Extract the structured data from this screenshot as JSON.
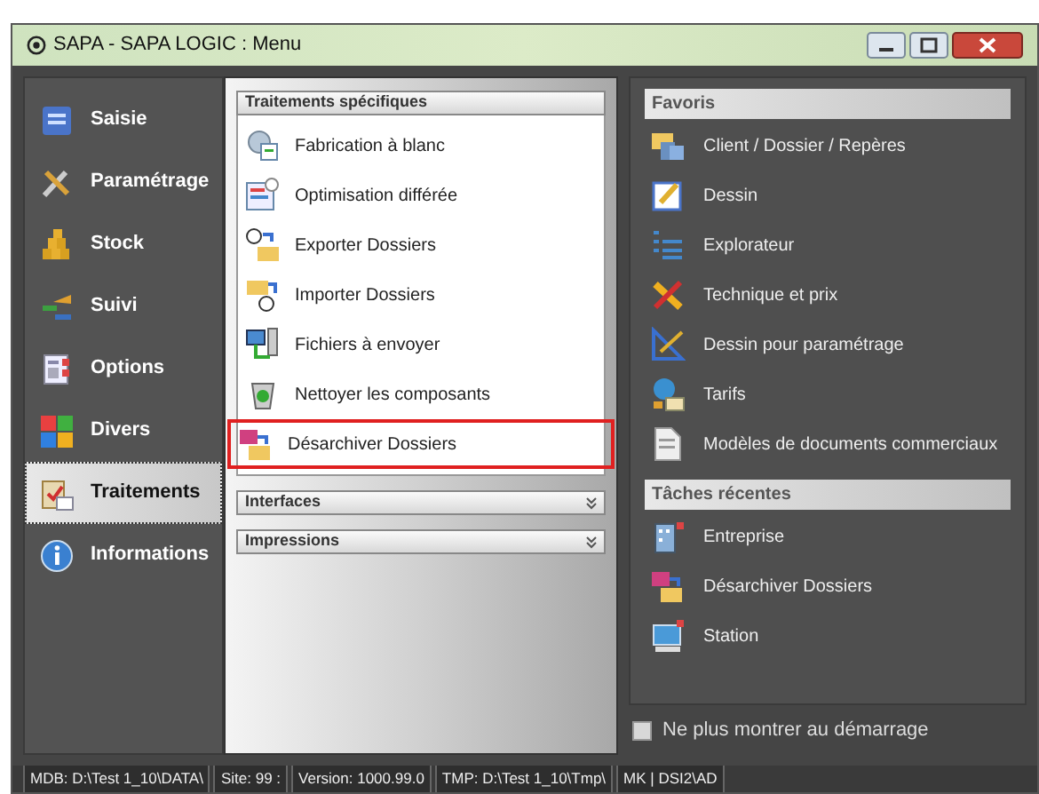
{
  "window": {
    "title": "SAPA - SAPA LOGIC : Menu"
  },
  "sidebar": {
    "items": [
      {
        "label": "Saisie",
        "selected": false
      },
      {
        "label": "Paramétrage",
        "selected": false
      },
      {
        "label": "Stock",
        "selected": false
      },
      {
        "label": "Suivi",
        "selected": false
      },
      {
        "label": "Options",
        "selected": false
      },
      {
        "label": "Divers",
        "selected": false
      },
      {
        "label": "Traitements",
        "selected": true
      },
      {
        "label": "Informations",
        "selected": false
      }
    ]
  },
  "sections": [
    {
      "title": "Traitements spécifiques",
      "expanded": true,
      "items": [
        {
          "label": "Fabrication à blanc",
          "highlighted": false
        },
        {
          "label": "Optimisation différée",
          "highlighted": false
        },
        {
          "label": "Exporter Dossiers",
          "highlighted": false
        },
        {
          "label": "Importer Dossiers",
          "highlighted": false
        },
        {
          "label": "Fichiers à envoyer",
          "highlighted": false
        },
        {
          "label": "Nettoyer les composants",
          "highlighted": false
        },
        {
          "label": "Désarchiver Dossiers",
          "highlighted": true
        }
      ]
    },
    {
      "title": "Interfaces",
      "expanded": false
    },
    {
      "title": "Impressions",
      "expanded": false
    }
  ],
  "favorites": {
    "title": "Favoris",
    "items": [
      "Client / Dossier / Repères",
      "Dessin",
      "Explorateur",
      "Technique et prix",
      "Dessin pour paramétrage",
      "Tarifs",
      "Modèles de documents commerciaux"
    ]
  },
  "recent_tasks": {
    "title": "Tâches récentes",
    "items": [
      "Entreprise",
      "Désarchiver Dossiers",
      "Station"
    ]
  },
  "startup_checkbox": {
    "label": "Ne plus montrer au démarrage",
    "checked": false
  },
  "status_bar": [
    "MDB: D:\\Test 1_10\\DATA\\",
    "Site: 99 :",
    "Version: 1000.99.0",
    "TMP: D:\\Test 1_10\\Tmp\\",
    "MK | DSI2\\AD"
  ]
}
